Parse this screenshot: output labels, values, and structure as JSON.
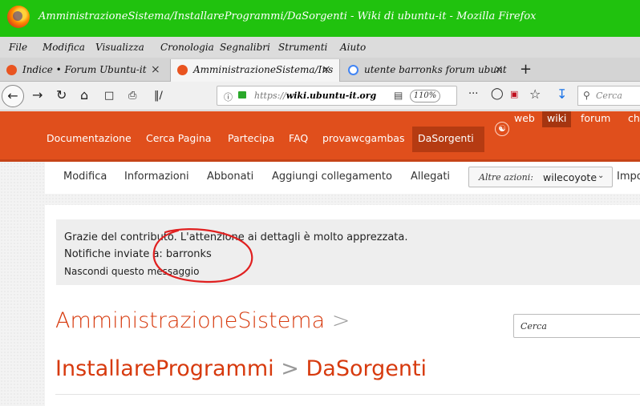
{
  "window": {
    "title": "AmministrazioneSistema/InstallareProgrammi/DaSorgenti - Wiki di ubuntu-it - Mozilla Firefox"
  },
  "menu": [
    "File",
    "Modifica",
    "Visualizza",
    "Cronologia",
    "Segnalibri",
    "Strumenti",
    "Aiuto"
  ],
  "tabs": [
    {
      "label": "Indice • Forum Ubuntu-it",
      "close": "×"
    },
    {
      "label": "AmministrazioneSistema/Ins",
      "close": "×"
    },
    {
      "label": "utente barronks forum ubunt",
      "close": "×"
    }
  ],
  "tab_new": "+",
  "nav": {
    "url_prefix": "https://",
    "url_host": "wiki.ubuntu-it.org",
    "zoom": "110%",
    "more": "···",
    "search_placeholder": "Cerca"
  },
  "site": {
    "nav": [
      "Documentazione",
      "Cerca Pagina",
      "Partecipa",
      "FAQ",
      "provawcgambas",
      "DaSorgenti"
    ],
    "top_links": [
      "web",
      "wiki",
      "forum",
      "ch"
    ]
  },
  "subnav": {
    "items": [
      "Modifica",
      "Informazioni",
      "Abbonati",
      "Aggiungi collegamento",
      "Allegati"
    ],
    "altre_label": "Altre azioni:",
    "altre_value": "wilecoyote",
    "overflow": "Impo"
  },
  "message": {
    "line1": "Grazie del contributo. L'attenzione ai dettagli è molto apprezzata.",
    "line2": "Notifiche inviate a: barronks",
    "hide": "Nascondi questo messaggio"
  },
  "breadcrumb": {
    "part1": "AmministrazioneSistema",
    "sep": ">",
    "part2": "InstallareProgrammi",
    "part3": "DaSorgenti"
  },
  "page_search": "Cerca",
  "colors": {
    "titlebar": "#20c20e",
    "ubuntu_orange": "#e04f1c",
    "link_red": "#d73a0e",
    "annotation": "#e02020"
  }
}
